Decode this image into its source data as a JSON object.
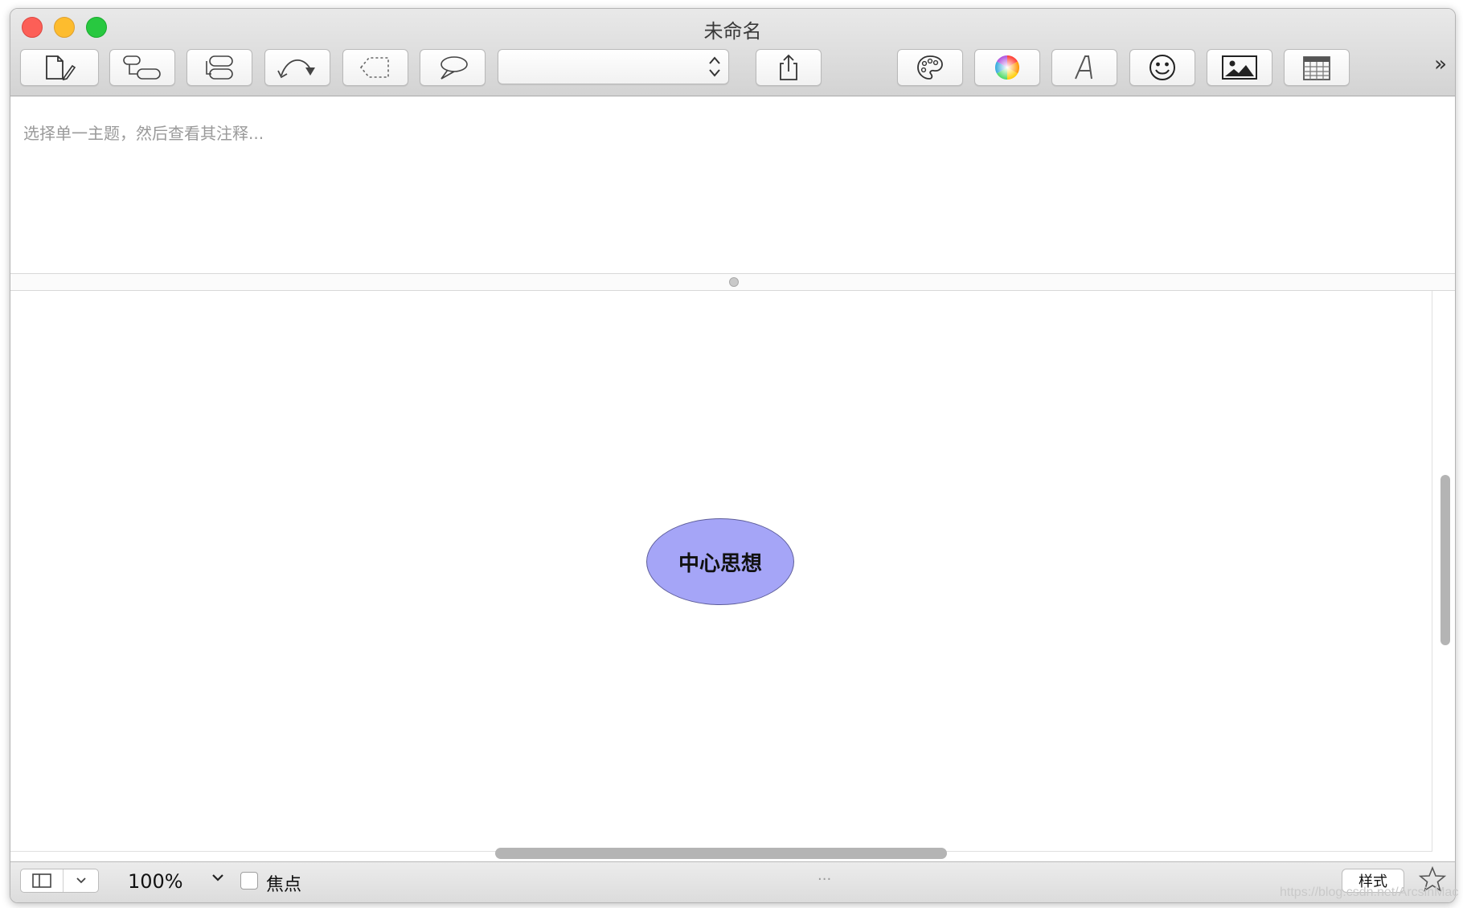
{
  "window": {
    "title": "未命名"
  },
  "notes": {
    "placeholder": "选择单一主题，然后查看其注释..."
  },
  "toolbar": {
    "buttons": [
      "new-document",
      "child-topic",
      "sibling-topic",
      "relationship",
      "boundary",
      "callout",
      "theme-selector",
      "share",
      "style",
      "colors",
      "fonts",
      "icons",
      "image",
      "calendar"
    ],
    "overflow": "»",
    "theme_selector_value": ""
  },
  "canvas": {
    "central_topic": "中心思想",
    "topic_color": "#a5a5f7"
  },
  "status": {
    "zoom": "100%",
    "focus_label": "焦点",
    "center_dots": "...",
    "style_label": "样式"
  },
  "watermark": "https://blog.csdn.net/ArcsinMac"
}
